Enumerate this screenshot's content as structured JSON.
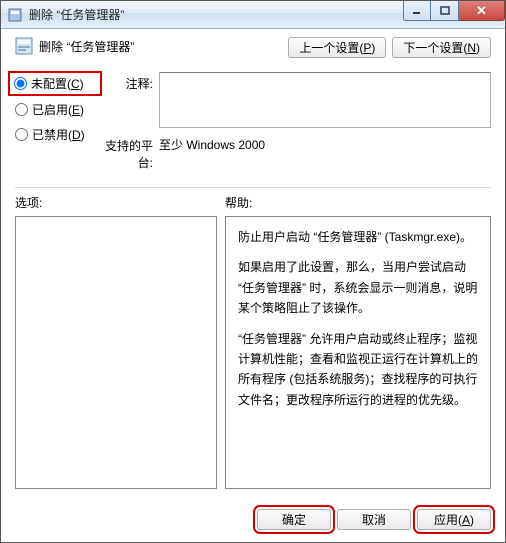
{
  "window": {
    "title": "删除 “任务管理器”"
  },
  "nav": {
    "prev": "上一个设置(",
    "prev_key": "P",
    "next": "下一个设置(",
    "next_key": "N",
    "close_paren": ")"
  },
  "header": {
    "title": "删除 “任务管理器”"
  },
  "radios": {
    "not_configured": {
      "label": "未配置(",
      "key": "C",
      "close": ")"
    },
    "enabled": {
      "label": "已启用(",
      "key": "E",
      "close": ")"
    },
    "disabled": {
      "label": "已禁用(",
      "key": "D",
      "close": ")"
    }
  },
  "fields": {
    "comment_label": "注释:",
    "comment_value": "",
    "platform_label": "支持的平台:",
    "platform_value": "至少 Windows 2000"
  },
  "panels": {
    "options_label": "选项:",
    "help_label": "帮助:"
  },
  "help_text": {
    "p1": "防止用户启动 “任务管理器” (Taskmgr.exe)。",
    "p2": "如果启用了此设置，那么，当用户尝试启动 “任务管理器” 时，系统会显示一则消息，说明某个策略阻止了该操作。",
    "p3": "“任务管理器” 允许用户启动或终止程序；监视计算机性能；查看和监视正运行在计算机上的所有程序 (包括系统服务)；查找程序的可执行文件名；更改程序所运行的进程的优先级。"
  },
  "buttons": {
    "ok": "确定",
    "cancel": "取消",
    "apply": "应用(",
    "apply_key": "A",
    "close_paren": ")"
  }
}
